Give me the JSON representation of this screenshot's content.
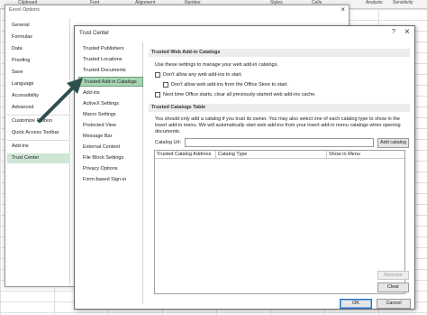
{
  "excel_ribbon": {
    "items": [
      "Clipboard",
      "Font",
      "Alignment",
      "Number",
      "Styles",
      "Cells",
      "Analysis",
      "Sensitivity"
    ]
  },
  "excel_options": {
    "title": "Excel Options",
    "close_glyph": "×",
    "items": [
      "General",
      "Formulas",
      "Data",
      "Proofing",
      "Save",
      "Language",
      "Accessibility",
      "Advanced",
      "Customize Ribbon",
      "Quick Access Toolbar",
      "Add-ins",
      "Trust Center"
    ],
    "selected": "Trust Center"
  },
  "trust_center": {
    "title": "Trust Center",
    "help_glyph": "?",
    "close_glyph": "×",
    "items": [
      "Trusted Publishers",
      "Trusted Locations",
      "Trusted Documents",
      "Trusted Add-in Catalogs",
      "Add-ins",
      "ActiveX Settings",
      "Macro Settings",
      "Protected View",
      "Message Bar",
      "External Content",
      "File Block Settings",
      "Privacy Options",
      "Form-based Sign-in"
    ],
    "selected": "Trusted Add-in Catalogs",
    "web_section": {
      "header": "Trusted Web Add-in Catalogs",
      "intro": "Use these settings to manage your web add-in catalogs.",
      "opt_no_start": "Don't allow any web add-ins to start.",
      "opt_no_store": "Don't allow web add-ins from the Office Store to start.",
      "opt_clear_cache": "Next time Office starts, clear all previously-started web add-ins cache."
    },
    "catalogs_section": {
      "header": "Trusted Catalogs Table",
      "desc_line1": "You should only add a catalog if you trust its owner. You may also select one of each catalog type to show in the",
      "desc_line2": "insert add-in menu. We will automatically start web add-ins from your insert add-in menu catalogs when opening",
      "desc_line3": "documents.",
      "catalog_url_label": "Catalog Url:",
      "catalog_url_value": "",
      "add_catalog_button": "Add catalog",
      "columns": [
        "Trusted Catalog Address",
        "Catalog Type",
        "Show in Menu"
      ],
      "remove_button": "Remove",
      "clear_button": "Clear"
    },
    "ok_button": "OK",
    "cancel_button": "Cancel"
  },
  "colors": {
    "selected_item": "#a8d5b3",
    "annotation_arrow": "#2f4f4f"
  }
}
